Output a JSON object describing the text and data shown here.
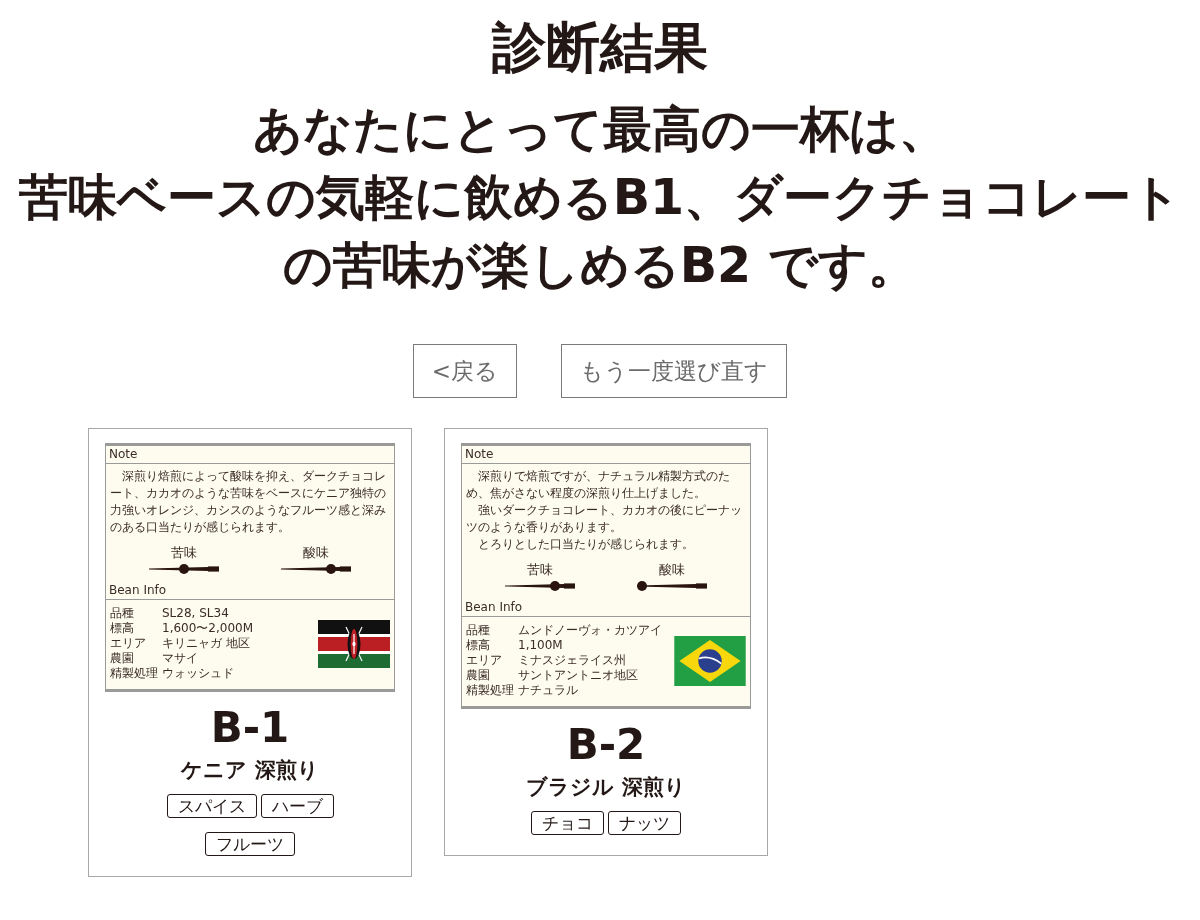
{
  "title": "診断結果",
  "headline_lines": [
    "あなたにとって最高の一杯は、",
    "苦味ベースの気軽に飲めるB1、ダークチョコレート",
    "の苦味が楽しめるB2 です。"
  ],
  "buttons": [
    "<戻る",
    "もう一度選び直す"
  ],
  "cards": [
    {
      "kind": "kenya",
      "label": {
        "note_heading": "Note",
        "note_paragraphs": [
          "深煎り焙煎によって酸味を抑え、ダークチョコレート、カカオのような苦味をベースにケニア独特の力強いオレンジ、カシスのようなフルーツ感と深みのある口当たりが感じられます。"
        ],
        "tastes": [
          {
            "label": "苦味",
            "level": 0.5
          },
          {
            "label": "酸味",
            "level": 0.75
          }
        ],
        "info_heading": "Bean Info",
        "info_rows": [
          {
            "label": "品種",
            "value": "SL28, SL34"
          },
          {
            "label": "標高",
            "value": "1,600〜2,000M"
          },
          {
            "label": "エリア",
            "value": "キリニャガ 地区"
          },
          {
            "label": "農園",
            "value": "マサイ"
          },
          {
            "label": "精製処理",
            "value": "ウォッシュド"
          }
        ]
      },
      "code": "B-1",
      "name": "ケニア 深煎り",
      "tags": [
        "スパイス",
        "ハーブ",
        "フルーツ"
      ]
    },
    {
      "kind": "brazil",
      "label": {
        "note_heading": "Note",
        "note_paragraphs": [
          "深煎りで焙煎ですが、ナチュラル精製方式のため、焦がさない程度の深煎り仕上げました。",
          "強いダークチョコレート、カカオの後にピーナッツのような香りがあります。",
          "とろりとした口当たりが感じられます。"
        ],
        "tastes": [
          {
            "label": "苦味",
            "level": 0.75
          },
          {
            "label": "酸味",
            "level": 0
          }
        ],
        "info_heading": "Bean Info",
        "info_rows": [
          {
            "label": "品種",
            "value": "ムンドノーヴォ・カツアイ"
          },
          {
            "label": "標高",
            "value": "1,100M"
          },
          {
            "label": "エリア",
            "value": "ミナスジェライス州"
          },
          {
            "label": "農園",
            "value": "サントアントニオ地区"
          },
          {
            "label": "精製処理",
            "value": "ナチュラル"
          }
        ]
      },
      "code": "B-2",
      "name": "ブラジル 深煎り",
      "tags": [
        "チョコ",
        "ナッツ"
      ]
    }
  ]
}
